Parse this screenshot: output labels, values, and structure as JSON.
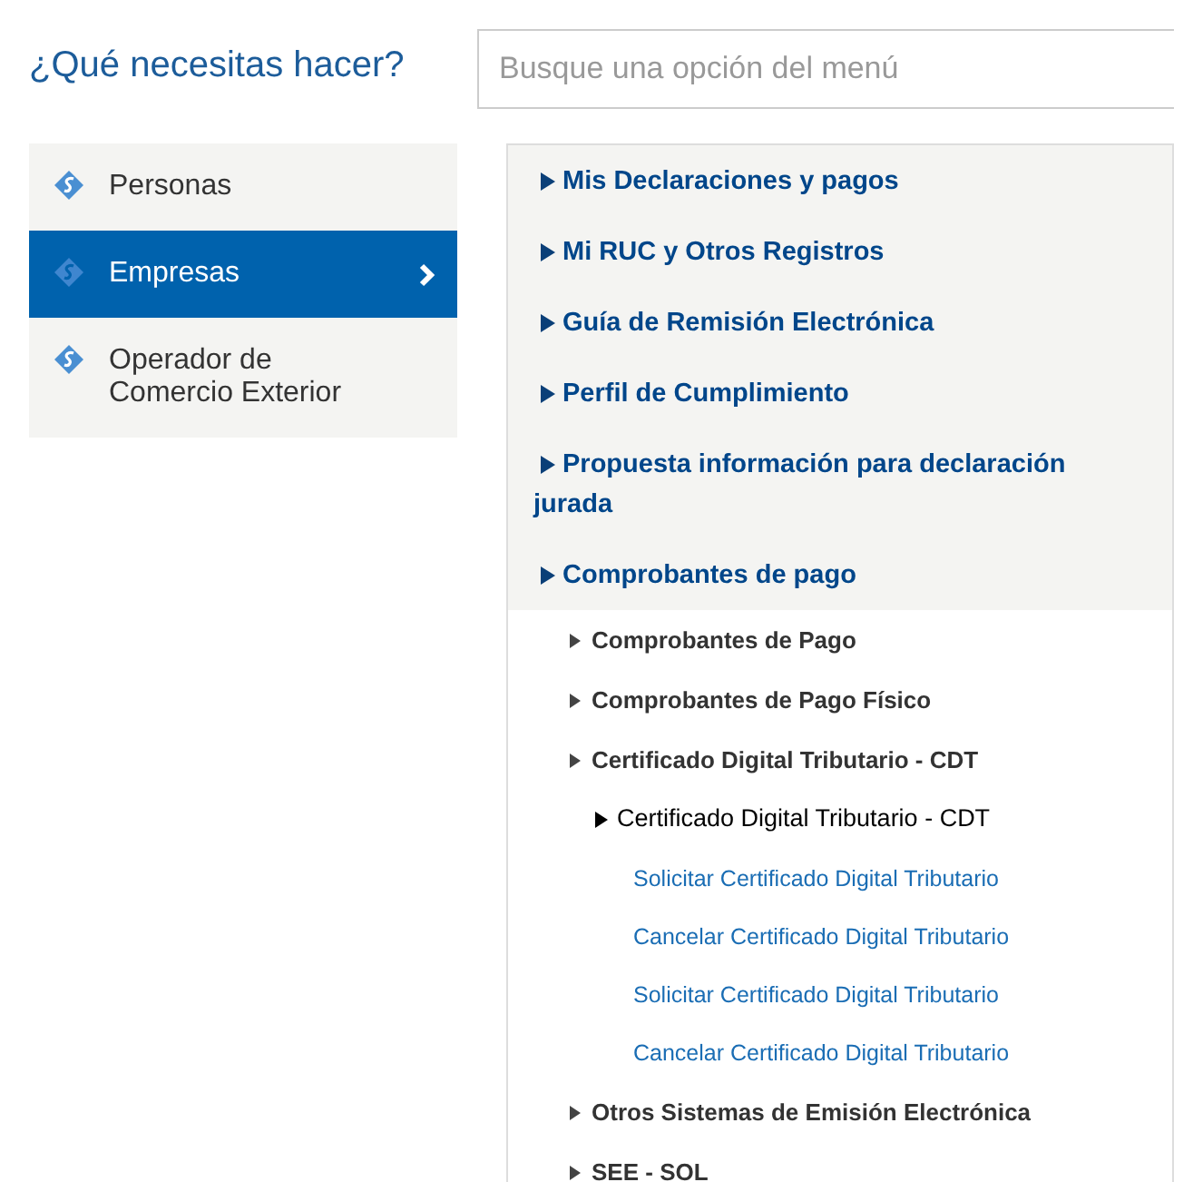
{
  "heading": "¿Qué necesitas hacer?",
  "search": {
    "placeholder": "Busque una opción del menú"
  },
  "categories": [
    {
      "label": "Personas",
      "selected": false
    },
    {
      "label": "Empresas",
      "selected": true
    },
    {
      "label": "Operador de Comercio Exterior",
      "selected": false
    }
  ],
  "menu": [
    {
      "label": "Mis Declaraciones y pagos"
    },
    {
      "label": "Mi RUC y Otros Registros"
    },
    {
      "label": "Guía de Remisión Electrónica"
    },
    {
      "label": "Perfil de Cumplimiento"
    },
    {
      "label": "Propuesta información para declaración jurada"
    },
    {
      "label": "Comprobantes de pago",
      "children": [
        {
          "label": "Comprobantes de Pago"
        },
        {
          "label": "Comprobantes de Pago Físico"
        },
        {
          "label": "Certificado Digital Tributario - CDT",
          "children": [
            {
              "label": "Certificado Digital Tributario - CDT",
              "children": [
                {
                  "label": "Solicitar Certificado Digital Tributario"
                },
                {
                  "label": "Cancelar Certificado Digital Tributario"
                },
                {
                  "label": "Solicitar Certificado Digital Tributario"
                },
                {
                  "label": "Cancelar Certificado Digital Tributario"
                }
              ]
            }
          ]
        },
        {
          "label": "Otros Sistemas de Emisión Electrónica"
        },
        {
          "label": "SEE - SOL"
        }
      ]
    }
  ]
}
